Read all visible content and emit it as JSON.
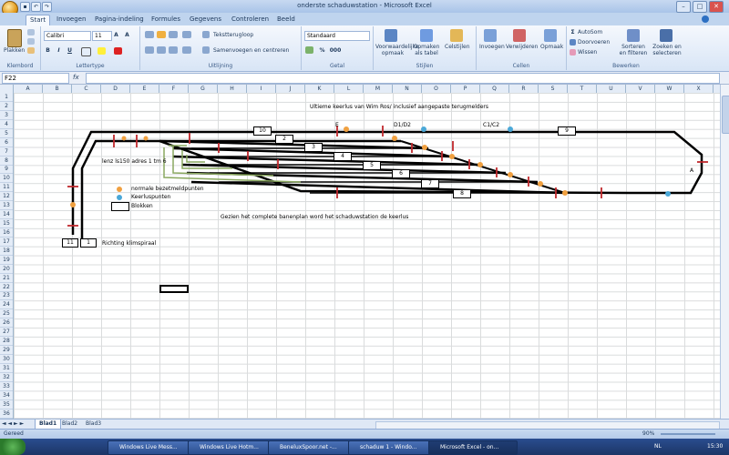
{
  "window": {
    "title": "onderste schaduwstation - Microsoft Excel",
    "minimize": "–",
    "maximize": "□",
    "close": "✕"
  },
  "ribbon": {
    "tabs": [
      "Start",
      "Invoegen",
      "Pagina-indeling",
      "Formules",
      "Gegevens",
      "Controleren",
      "Beeld"
    ],
    "clipboard": {
      "paste": "Plakken",
      "label": "Klembord"
    },
    "font": {
      "name": "Calibri",
      "size": "11",
      "label": "Lettertype",
      "bold": "B",
      "italic": "I",
      "underline": "U"
    },
    "alignment": {
      "wrap": "Tekstterugloop",
      "merge": "Samenvoegen en centreren",
      "label": "Uitlijning"
    },
    "number": {
      "format": "Standaard",
      "percent": "%",
      "thousands": "000",
      "label": "Getal"
    },
    "styles": {
      "conditional": "Voorwaardelijke opmaak",
      "table": "Opmaken als tabel",
      "cell": "Celstijlen",
      "label": "Stijlen"
    },
    "cells": {
      "insert": "Invoegen",
      "delete": "Verwijderen",
      "format": "Opmaak",
      "label": "Cellen"
    },
    "editing": {
      "autosum": "AutoSom",
      "fill": "Doorvoeren",
      "clear": "Wissen",
      "sort": "Sorteren en filteren",
      "find": "Zoeken en selecteren",
      "label": "Bewerken"
    }
  },
  "formula_bar": {
    "name_box": "F22",
    "fx": "fx",
    "formula": ""
  },
  "columns": [
    "A",
    "B",
    "C",
    "D",
    "E",
    "F",
    "G",
    "H",
    "I",
    "J",
    "K",
    "L",
    "M",
    "N",
    "O",
    "P",
    "Q",
    "R",
    "S",
    "T",
    "U",
    "V",
    "W",
    "X"
  ],
  "rows": [
    "1",
    "2",
    "3",
    "4",
    "5",
    "6",
    "7",
    "8",
    "9",
    "10",
    "11",
    "12",
    "13",
    "14",
    "15",
    "16",
    "17",
    "18",
    "19",
    "20",
    "21",
    "22",
    "23",
    "24",
    "25",
    "26",
    "27",
    "28",
    "29",
    "30",
    "31",
    "32",
    "33",
    "34",
    "35",
    "36"
  ],
  "diagram": {
    "title": "Ultieme keerlus van Wim Ros/ inclusief aangepaste terugmelders",
    "label_E": "E",
    "label_D1D2": "D1/D2",
    "label_C1C2": "C1/C2",
    "label_A": "A",
    "lenz": "lenz ls150 adres 1 tm 6",
    "legend_occupancy": "normale bezetmeldpunten",
    "legend_loop": "Keerluspunten",
    "legend_blocks": "Blokken",
    "note": "Gezien het complete banenplan word het schaduwstation de keerlus",
    "direction": "Richting klimspiraal",
    "blocks": [
      "10",
      "2",
      "3",
      "4",
      "5",
      "6",
      "7",
      "8",
      "9",
      "11",
      "1"
    ],
    "colors": {
      "occupancy": "#f0a040",
      "loop": "#4aa8d8",
      "track": "#000000",
      "isolation": "#c0282c",
      "arrow": "#8aa860"
    }
  },
  "sheets": [
    "Blad1",
    "Blad2",
    "Blad3"
  ],
  "status": {
    "ready": "Gereed",
    "zoom": "90%"
  },
  "taskbar": {
    "items": [
      "Windows Live Mess...",
      "Windows Live Hotm...",
      "BeneluxSpoor.net -...",
      "schaduw 1 - Windo...",
      "Microsoft Excel - on..."
    ],
    "lang": "NL",
    "clock": "15:30"
  }
}
